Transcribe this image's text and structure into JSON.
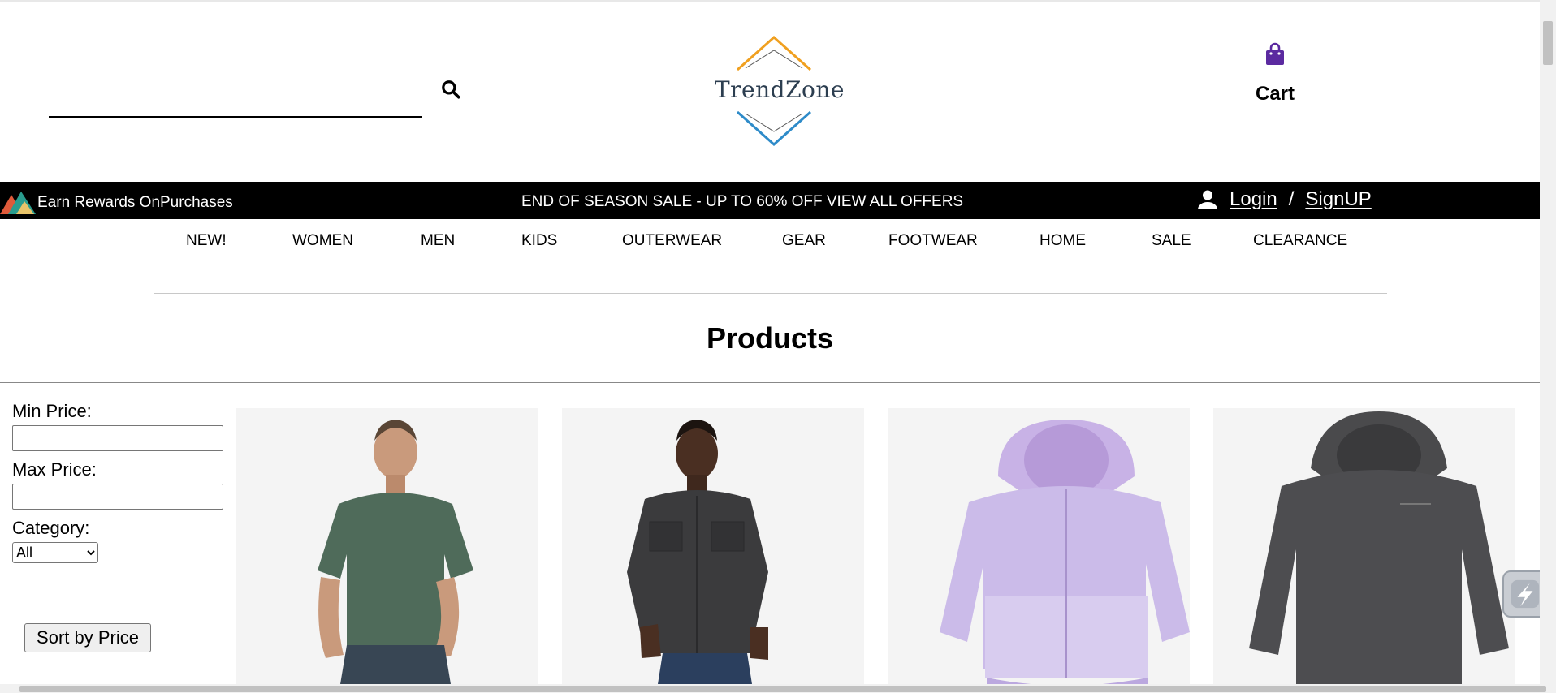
{
  "header": {
    "search_placeholder": "",
    "search_value": "",
    "logo_text": "TrendZone",
    "cart_label": "Cart"
  },
  "promo_bar": {
    "rewards_text": "Earn Rewards OnPurchases",
    "sale_text": "END OF SEASON SALE - UP TO 60% OFF VIEW ALL OFFERS",
    "login_label": "Login",
    "separator": "/",
    "signup_label": "SignUP"
  },
  "nav": {
    "items": [
      {
        "label": "NEW!"
      },
      {
        "label": "WOMEN"
      },
      {
        "label": "MEN"
      },
      {
        "label": "KIDS"
      },
      {
        "label": "OUTERWEAR"
      },
      {
        "label": "GEAR"
      },
      {
        "label": "FOOTWEAR"
      },
      {
        "label": "HOME"
      },
      {
        "label": "SALE"
      },
      {
        "label": "CLEARANCE"
      }
    ]
  },
  "main": {
    "title": "Products"
  },
  "filters": {
    "min_price_label": "Min Price:",
    "min_price_value": "",
    "max_price_label": "Max Price:",
    "max_price_value": "",
    "category_label": "Category:",
    "category_selected": "All",
    "sort_label": "Sort by Price"
  },
  "products": [
    {
      "icon": "green-tshirt-man-image"
    },
    {
      "icon": "dark-shirt-man-image"
    },
    {
      "icon": "lavender-kids-jacket-image"
    },
    {
      "icon": "charcoal-hoodie-image"
    }
  ],
  "colors": {
    "promo_bar_bg": "#000000",
    "cart_icon": "#5b2aa0",
    "logo_orange": "#f0a020",
    "logo_blue": "#2e8bc9",
    "logo_text": "#2c3e50"
  }
}
